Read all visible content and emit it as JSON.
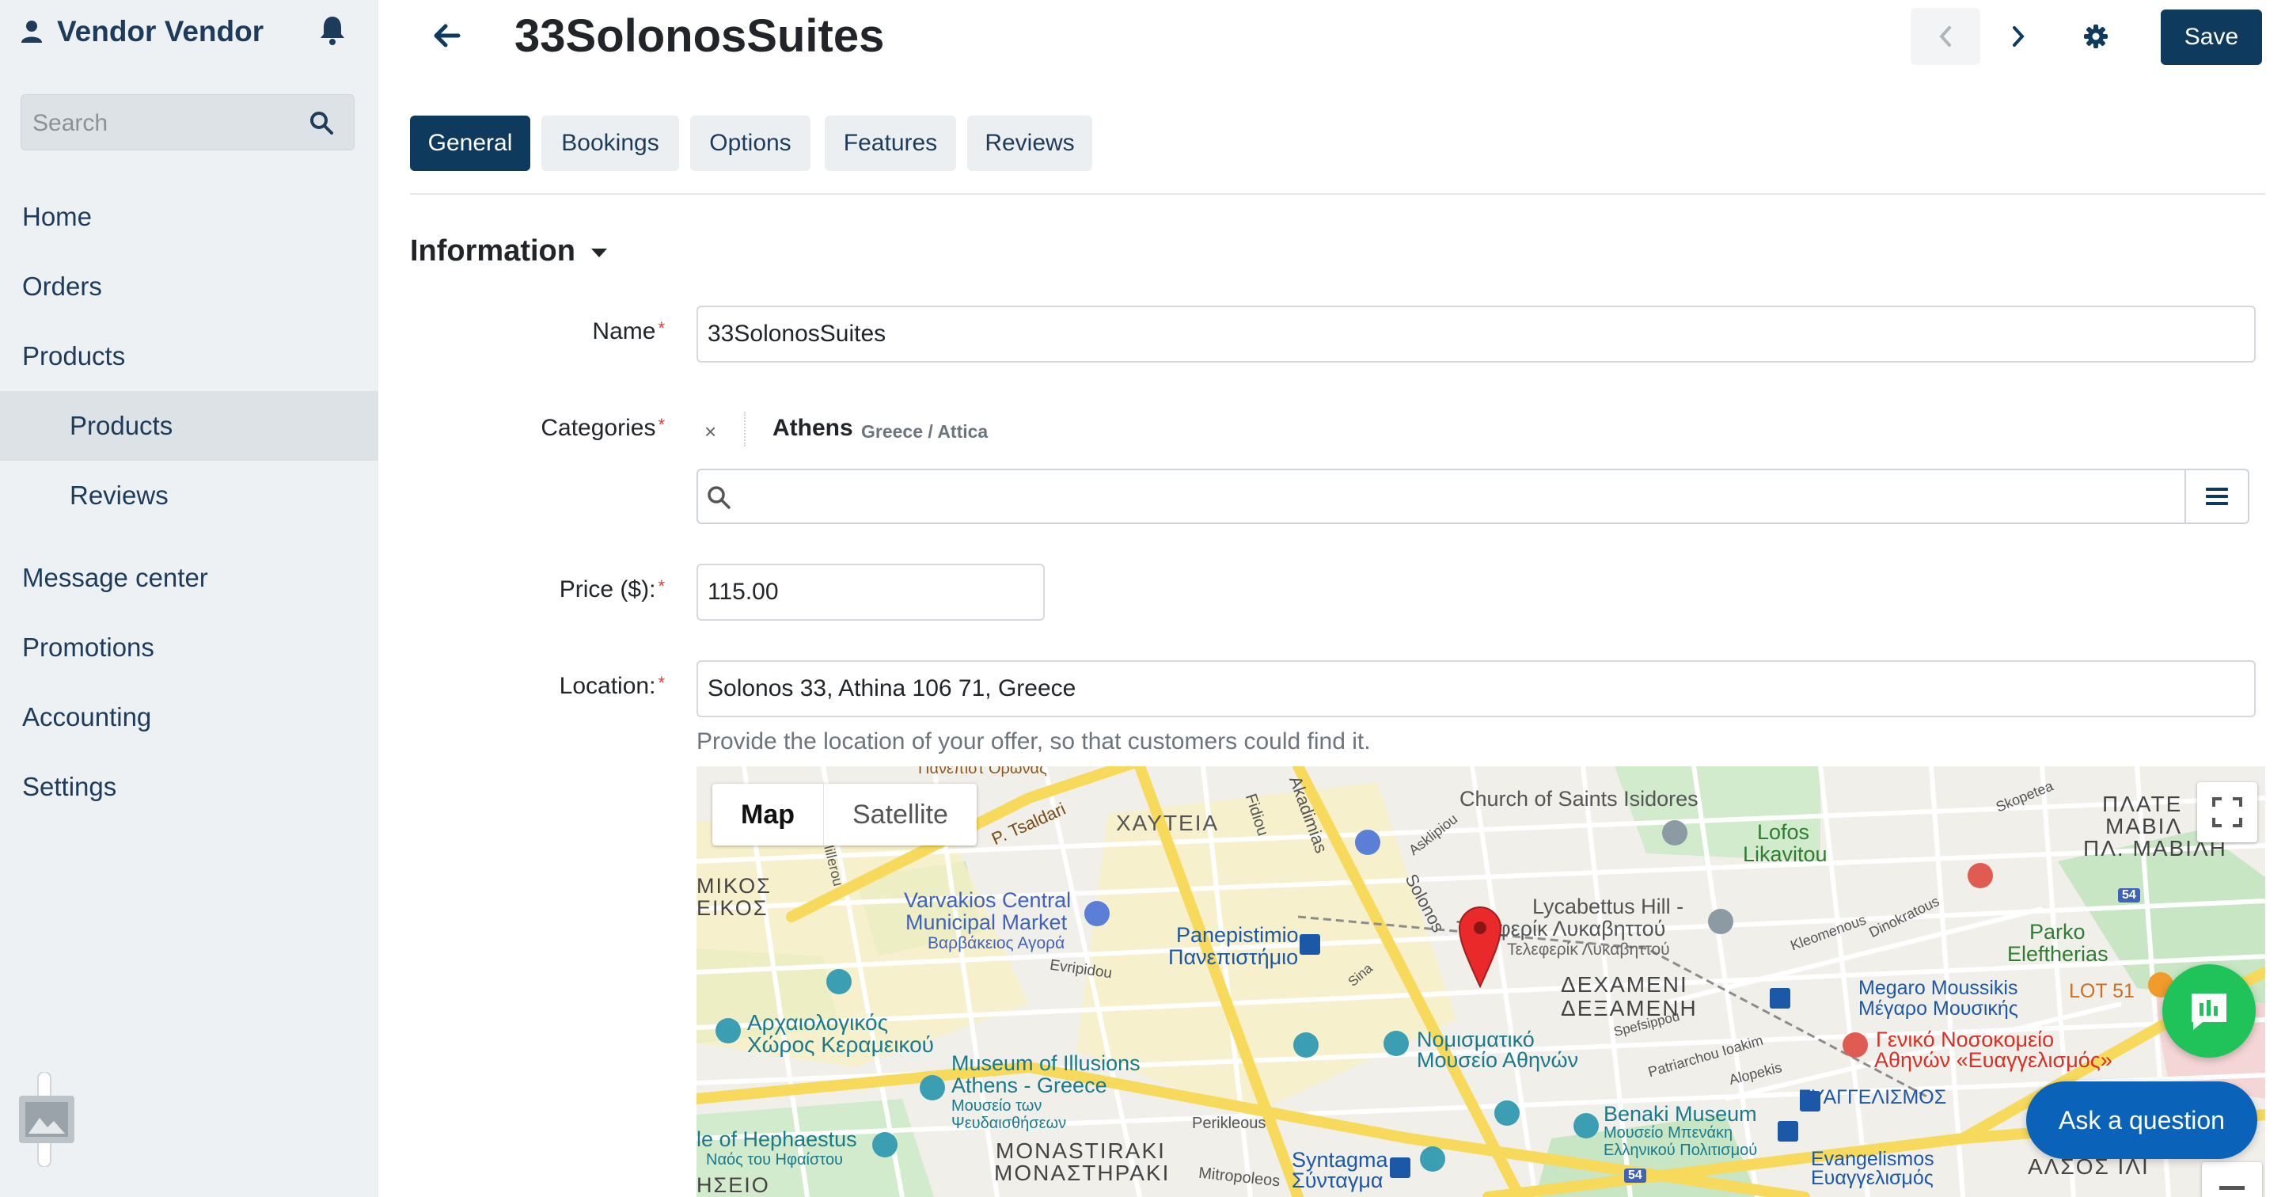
{
  "sidebar": {
    "user_name": "Vendor Vendor",
    "search_placeholder": "Search",
    "items": [
      {
        "label": "Home"
      },
      {
        "label": "Orders"
      },
      {
        "label": "Products"
      },
      {
        "label": "Products"
      },
      {
        "label": "Reviews"
      },
      {
        "label": "Message center"
      },
      {
        "label": "Promotions"
      },
      {
        "label": "Accounting"
      },
      {
        "label": "Settings"
      }
    ]
  },
  "header": {
    "title": "33SolonosSuites",
    "save_label": "Save"
  },
  "tabs": [
    {
      "label": "General"
    },
    {
      "label": "Bookings"
    },
    {
      "label": "Options"
    },
    {
      "label": "Features"
    },
    {
      "label": "Reviews"
    }
  ],
  "section": {
    "title": "Information"
  },
  "form": {
    "name": {
      "label": "Name",
      "required": "*",
      "value": "33SolonosSuites"
    },
    "categories": {
      "label": "Categories",
      "required": "*",
      "chip_remove": "×",
      "chip_name": "Athens",
      "chip_path": "Greece / Attica",
      "search_value": ""
    },
    "price": {
      "label": "Price ($):",
      "required": "*",
      "value": "115.00"
    },
    "location": {
      "label": "Location:",
      "required": "*",
      "value": "Solonos 33, Athina 106 71, Greece",
      "help": "Provide the location of your offer, so that customers could find it."
    }
  },
  "map": {
    "type_map": "Map",
    "type_satellite": "Satellite",
    "labels": [
      {
        "text": "P. Tsaldari"
      },
      {
        "text": "ΧΑΥΤΕΙΑ"
      },
      {
        "text": "Fidiou"
      },
      {
        "text": "Akadimias"
      },
      {
        "text": "Church of Saints Isidores"
      },
      {
        "text": "Skopetea"
      },
      {
        "text": "ΠΛΑΤΕ"
      },
      {
        "text": "ΜΑΒΙΛ"
      },
      {
        "text": "ΠΛ. ΜΑΒΙΛΗ"
      },
      {
        "text": "Lofos"
      },
      {
        "text": "Likavitou"
      },
      {
        "text": "Asklipiou"
      },
      {
        "text": "Solonos"
      },
      {
        "text": "ΜΙΚΟΣ"
      },
      {
        "text": "ΕΙΚΟΣ"
      },
      {
        "text": "Millerou"
      },
      {
        "text": "Varvakios Central"
      },
      {
        "text": "Municipal Market"
      },
      {
        "text": "Βαρβάκειος Αγορά"
      },
      {
        "text": "Evripidou"
      },
      {
        "text": "Panepistimio"
      },
      {
        "text": "Πανεπιστήμιο"
      },
      {
        "text": "Lycabettus Hill -"
      },
      {
        "text": "Τελεφερίκ Λυκαβηττού"
      },
      {
        "text": "Τελεφερίκ Λυκαβηττού"
      },
      {
        "text": "Kleomenous"
      },
      {
        "text": "Dinokratous"
      },
      {
        "text": "Parko"
      },
      {
        "text": "Eleftherias"
      },
      {
        "text": "Sina"
      },
      {
        "text": "ΔΕΧΑΜΕΝΙ"
      },
      {
        "text": "ΔΕΞΑΜΕΝΗ"
      },
      {
        "text": "Megaro Moussikis"
      },
      {
        "text": "Μέγαρο Μουσικής"
      },
      {
        "text": "LOT 51"
      },
      {
        "text": "Αρχαιολογικός"
      },
      {
        "text": "Χώρος Κεραμεικού"
      },
      {
        "text": "Νομισματικό"
      },
      {
        "text": "Μουσείο Αθηνών"
      },
      {
        "text": "Spefsippou"
      },
      {
        "text": "Patriarchou Ioakim"
      },
      {
        "text": "Γενικό Νοσοκομείο"
      },
      {
        "text": "Αθηνών «Ευαγγελισμός»"
      },
      {
        "text": "Museum of Illusions"
      },
      {
        "text": "Athens - Greece"
      },
      {
        "text": "Μουσείο των"
      },
      {
        "text": "Ψευδαισθήσεων"
      },
      {
        "text": "Alopekis"
      },
      {
        "text": "ΕΥΑΓΓΕΛΙΣΜΟΣ"
      },
      {
        "text": "Perikleous"
      },
      {
        "text": "Benaki Museum"
      },
      {
        "text": "Μουσείο Μπενάκη"
      },
      {
        "text": "Ελληνικού Πολιτισμού"
      },
      {
        "text": "le of Hephaestus"
      },
      {
        "text": "Ναός του Ηφαίστου"
      },
      {
        "text": "ΗΣΕΙΟ"
      },
      {
        "text": "MONASTIRAKI"
      },
      {
        "text": "ΜΟΝΑΣΤΗΡΑΚΙ"
      },
      {
        "text": "Mitropoleos"
      },
      {
        "text": "Syntagma"
      },
      {
        "text": "Σύνταγμα"
      },
      {
        "text": "Evangelismos"
      },
      {
        "text": "Ευαγγελισμός"
      },
      {
        "text": "ΑΛΣΟΣ ΙΛΙ"
      },
      {
        "text": "54"
      },
      {
        "text": "54"
      },
      {
        "text": "Πανεπιστ Ορωνας"
      }
    ]
  },
  "chat": {
    "ask_label": "Ask a question"
  },
  "colors": {
    "primary": "#0e3a5e",
    "sidebar_bg": "#edf1f4",
    "required": "#e53935",
    "chat_green": "#1fc35a",
    "ask_blue": "#0a63b8",
    "map_pin": "#ea2a2a"
  },
  "icons": {
    "user": "user-icon",
    "bell": "bell-icon",
    "search": "search-icon",
    "back": "arrow-left-icon",
    "prev": "chevron-left-icon",
    "next": "chevron-right-icon",
    "settings": "gear-icon",
    "menu": "hamburger-icon",
    "fullscreen": "fullscreen-icon",
    "chat": "chat-icon"
  }
}
